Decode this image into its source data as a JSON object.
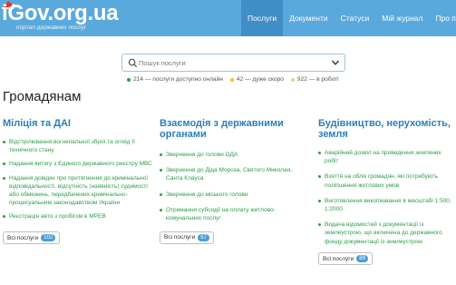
{
  "header": {
    "logo": "iGov.org.ua",
    "tagline": "портал державних послуг",
    "nav": [
      "Послуги",
      "Документи",
      "Статуси",
      "Мій журнал",
      "Про портал"
    ]
  },
  "search": {
    "placeholder": "Пошук послуги"
  },
  "stats": [
    {
      "text": "214 — послуги доступно онлайн",
      "color": "#2e9e48"
    },
    {
      "text": "42 — дуже скоро",
      "color": "#f0c419"
    },
    {
      "text": "922 — в роботі",
      "color": "#e8d27a"
    }
  ],
  "page_title": "Громадянам",
  "columns": [
    {
      "title": "Міліція та ДАІ",
      "items": [
        "Відстрілювання вогнепальної зброї та огляд її технічного стану",
        "Надання витягу з Єдиного державного реєстру МВС",
        "Надання довідки про притягнення до кримінальної відповідальності, відсутність (наявність) судимості або обмежень, передбачених кримінально-процесуальним законодавством України",
        "Реєстрація авто з пробігом в МРЕВ"
      ],
      "all_label": "Всі послуги",
      "count": "102"
    },
    {
      "title": "Взаємодія з державними органами",
      "items": [
        "Звернення до голови ОДА",
        "Звернення до Діда Мороза, Святого Миколая, Санта Клауса",
        "Звернення до міського голови",
        "Отримання субсидії на оплату житлово-комунальних послуг"
      ],
      "all_label": "Всі послуги",
      "count": "57"
    },
    {
      "title": "Будівництво, нерухомість, земля",
      "items": [
        "Аварійний дозвіл на проведення земляних робіт",
        "Взяття на облік громадян, які потребують поліпшення житлових умов",
        "Виготовлення викопіювання в масштабі 1:500, 1:2000",
        "Видача відомостей з документації із землеустрою, що включена до державного фонду документації із землеустрою"
      ],
      "all_label": "Всі послуги",
      "count": "89"
    }
  ]
}
